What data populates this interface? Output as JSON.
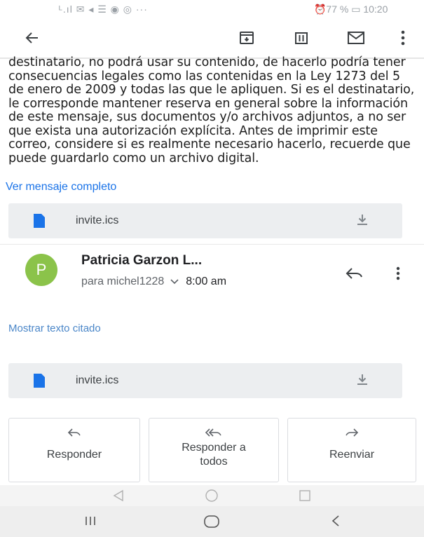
{
  "status_bar": {
    "left": "ᴸ.ıl ✉ ◂ ☰ ◉ ◎ ···",
    "right": "⏰77 % ▭ 10:20"
  },
  "toolbar": {
    "back_icon": "arrow-left-icon",
    "archive_icon": "archive-icon",
    "delete_icon": "trash-icon",
    "mail_icon": "envelope-icon",
    "more_icon": "more-vert-icon"
  },
  "message_body": {
    "text": "destinatario, no podrá usar su contenido, de hacerlo podría tener consecuencias legales como las contenidas en la Ley 1273 del 5 de enero de 2009 y todas las que le apliquen. Si es el destinatario, le corresponde mantener reserva en general sobre la información de este mensaje, sus documentos y/o archivos adjuntos, a no ser que exista una autorización explícita. Antes de imprimir este correo, considere si es realmente necesario hacerlo, recuerde que puede guardarlo como un archivo digital."
  },
  "view_full_message": "Ver mensaje completo",
  "attachments": [
    {
      "name": "invite.ics"
    },
    {
      "name": "invite.ics"
    }
  ],
  "message": {
    "avatar_letter": "P",
    "sender": "Patricia Garzon L...",
    "recipient": "para michel1228",
    "time": "8:00 am"
  },
  "show_quoted_text": "Mostrar texto citado",
  "actions": {
    "reply": "Responder",
    "reply_all_line1": "Responder a",
    "reply_all_line2": "todos",
    "forward": "Reenviar"
  },
  "colors": {
    "link": "#1a73e8",
    "avatar": "#8bc34a",
    "attachment_bg": "#eceef0",
    "file_icon": "#1a73e8"
  }
}
